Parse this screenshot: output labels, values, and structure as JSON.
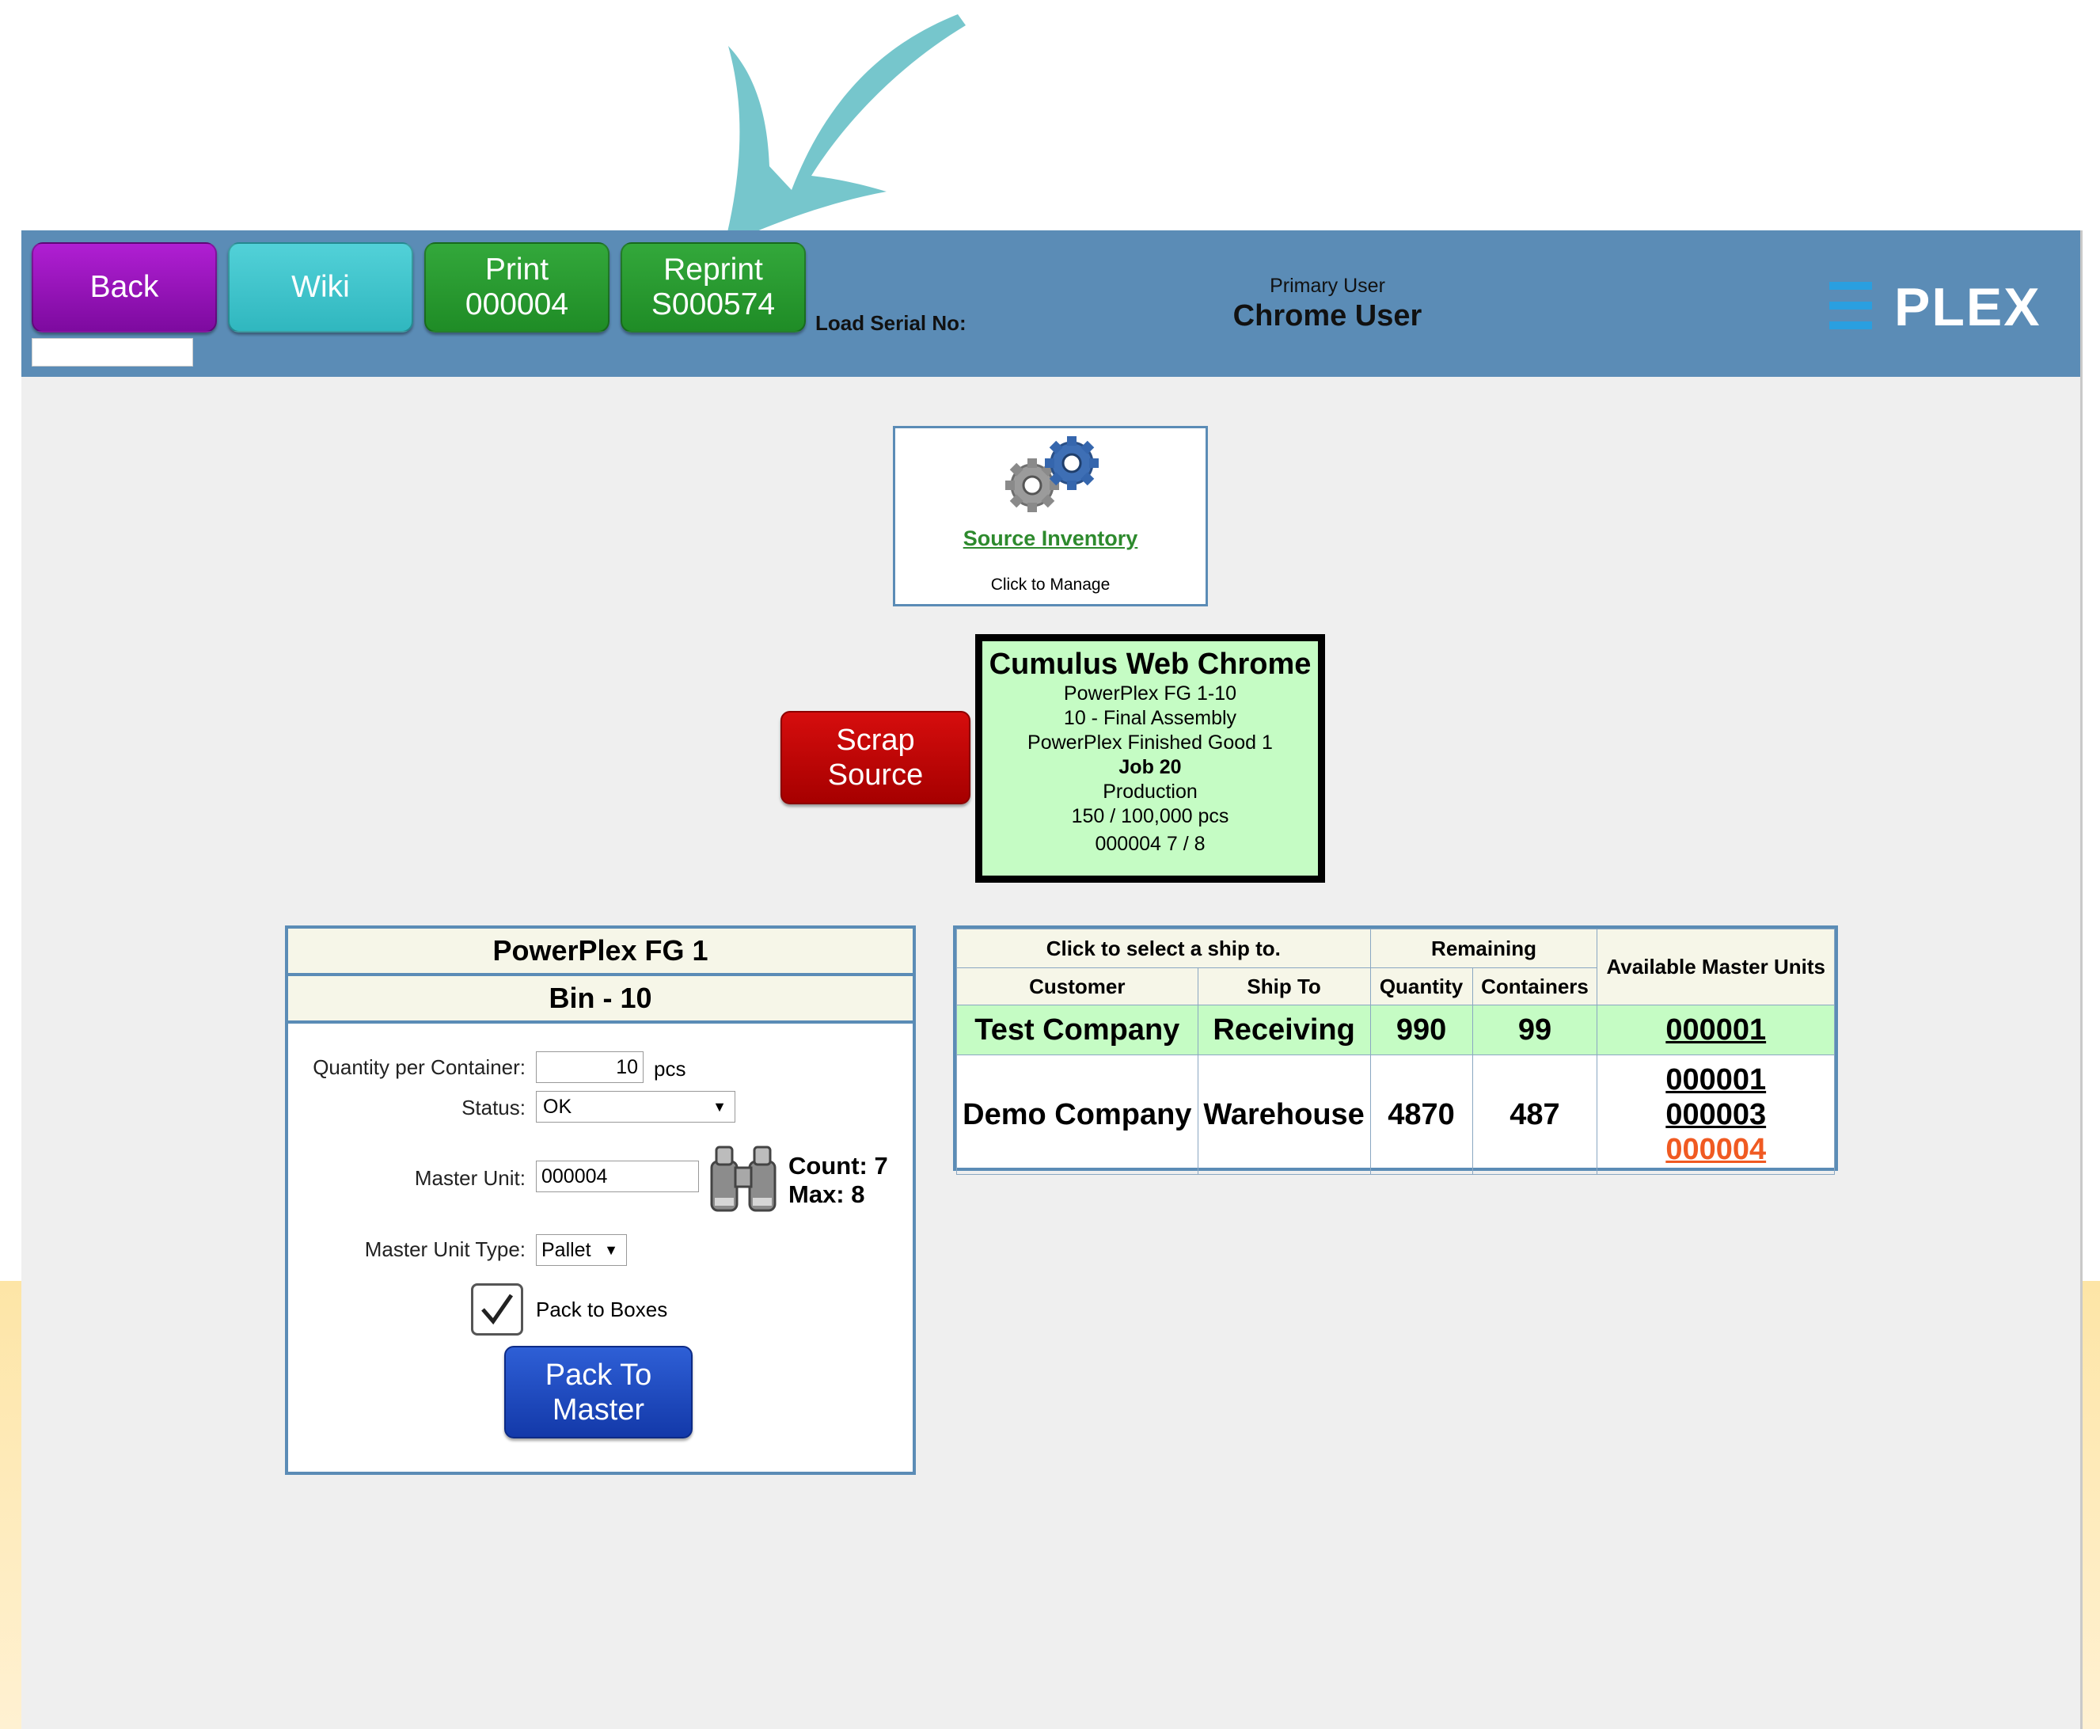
{
  "header": {
    "back_label": "Back",
    "wiki_label": "Wiki",
    "print_line1": "Print",
    "print_line2": "000004",
    "reprint_line1": "Reprint",
    "reprint_line2": "S000574",
    "load_serial_label": "Load Serial No:",
    "user_role": "Primary User",
    "user_name": "Chrome User",
    "logo_text": "PLEX"
  },
  "source_inventory": {
    "link": "Source Inventory",
    "sub": "Click to Manage"
  },
  "scrap": {
    "line1": "Scrap",
    "line2": "Source"
  },
  "job_card": {
    "title": "Cumulus Web Chrome",
    "part": "PowerPlex FG 1-10",
    "operation": "10 - Final Assembly",
    "description": "PowerPlex Finished Good 1",
    "job": "Job 20",
    "type": "Production",
    "qty": "150 / 100,000 pcs",
    "container": "000004 7 / 8"
  },
  "part_panel": {
    "title": "PowerPlex FG 1",
    "bin": "Bin - 10",
    "qty_label": "Quantity per Container:",
    "qty_value": "10",
    "qty_unit": "pcs",
    "status_label": "Status:",
    "status_value": "OK",
    "master_label": "Master Unit:",
    "master_value": "000004",
    "count": "Count: 7",
    "max": "Max: 8",
    "type_label": "Master Unit Type:",
    "type_value": "Pallet",
    "pack_boxes": "Pack to Boxes",
    "pack_line1": "Pack To",
    "pack_line2": "Master"
  },
  "ship_table": {
    "header_select": "Click to select a ship to.",
    "header_remaining": "Remaining",
    "col_customer": "Customer",
    "col_shipto": "Ship To",
    "col_quantity": "Quantity",
    "col_containers": "Containers",
    "col_available": "Available Master Units",
    "rows": [
      {
        "customer": "Test Company",
        "ship_to": "Receiving",
        "quantity": "990",
        "containers": "99",
        "units": [
          "000001"
        ]
      },
      {
        "customer": "Demo Company",
        "ship_to": "Warehouse",
        "quantity": "4870",
        "containers": "487",
        "units": [
          "000001",
          "000003",
          "000004"
        ]
      }
    ]
  },
  "colors": {
    "header_bg": "#5b8cb6",
    "back": "#9b16bf",
    "wiki": "#3fc4cb",
    "print": "#279a2f",
    "scrap": "#c00000",
    "pack": "#1f4bc1",
    "job_card_bg": "#c5fcc4",
    "active_unit": "#f05a22",
    "annotation_arrow": "#6fc3c9"
  }
}
